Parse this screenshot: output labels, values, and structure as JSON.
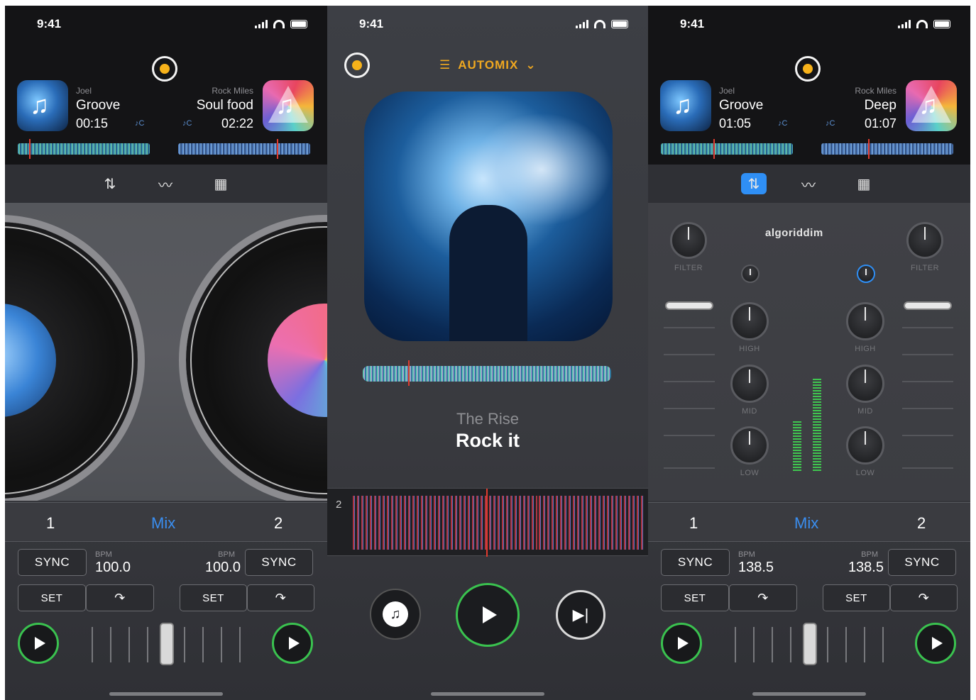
{
  "status": {
    "time": "9:41"
  },
  "phone1": {
    "deckA": {
      "artist": "Joel",
      "title": "Groove",
      "time": "00:15",
      "key": "♪C"
    },
    "deckB": {
      "artist": "Rock Miles",
      "title": "Soul food",
      "time": "02:22",
      "key": "♪C"
    },
    "tabs": [
      "mixer-icon",
      "waveform-icon",
      "grid-icon"
    ],
    "deck_labels": {
      "left": "1",
      "mix": "Mix",
      "right": "2"
    },
    "left": {
      "sync": "SYNC",
      "bpm_label": "BPM",
      "bpm": "100.0",
      "set": "SET"
    },
    "right": {
      "sync": "SYNC",
      "bpm_label": "BPM",
      "bpm": "100.0",
      "set": "SET"
    },
    "crossfader_position": 0.5
  },
  "phone2": {
    "automix_label": "AUTOMIX",
    "track_artist": "The Rise",
    "track_title": "Rock it",
    "zoom_label": "2"
  },
  "phone3": {
    "deckA": {
      "artist": "Joel",
      "title": "Groove",
      "time": "01:05",
      "key": "♪C"
    },
    "deckB": {
      "artist": "Rock Miles",
      "title": "Deep",
      "time": "01:07",
      "key": "♪C"
    },
    "brand": "algoriddim",
    "knobs": {
      "filter": "FILTER",
      "high": "HIGH",
      "mid": "MID",
      "low": "LOW"
    },
    "deck_labels": {
      "left": "1",
      "mix": "Mix",
      "right": "2"
    },
    "left": {
      "sync": "SYNC",
      "bpm_label": "BPM",
      "bpm": "138.5",
      "set": "SET"
    },
    "right": {
      "sync": "SYNC",
      "bpm_label": "BPM",
      "bpm": "138.5",
      "set": "SET"
    }
  },
  "colors": {
    "accent": "#3a8ef0",
    "play": "#3ac24f",
    "record": "#f7b21a",
    "automix": "#f0a820",
    "playhead": "#e23b2e"
  }
}
